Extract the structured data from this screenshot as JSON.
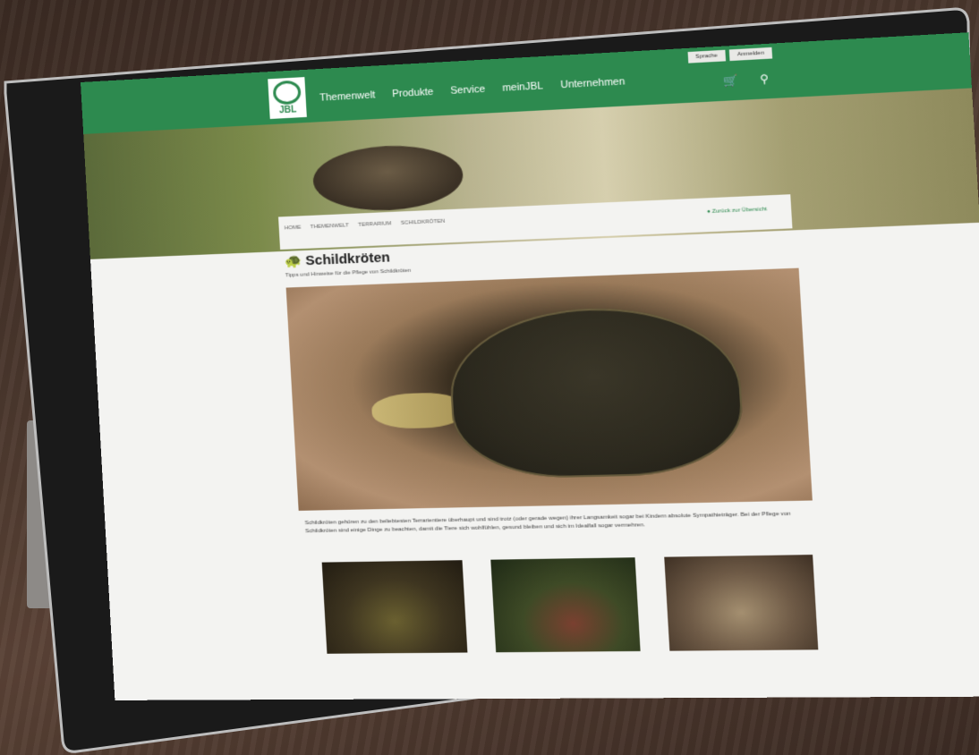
{
  "site": {
    "logo_text": "JBL",
    "top_buttons": [
      "Sprache",
      "Anmelden"
    ],
    "nav": [
      "Themenwelt",
      "Produkte",
      "Service",
      "meinJBL",
      "Unternehmen"
    ],
    "icons": [
      "cart-icon",
      "search-icon"
    ]
  },
  "breadcrumbs": [
    "HOME",
    "THEMENWELT",
    "TERRARIUM",
    "SCHILDKRÖTEN"
  ],
  "back_link": "Zurück zur Übersicht",
  "page": {
    "title": "Schildkröten",
    "subtitle": "Tipps und Hinweise für die Pflege von Schildkröten",
    "paragraph": "Schildkröten gehören zu den beliebtesten Terrarientiere überhaupt und sind trotz (oder gerade wegen) ihrer Langsamkeit sogar bei Kindern absolute Sympathieträger. Bei der Pflege von Schildkröten sind einige Dinge zu beachten, damit die Tiere sich wohlfühlen, gesund bleiben und sich im Idealfall sogar vermehren."
  },
  "colors": {
    "brand_green": "#2d8a4f",
    "page_bg": "#f3f3f1"
  }
}
